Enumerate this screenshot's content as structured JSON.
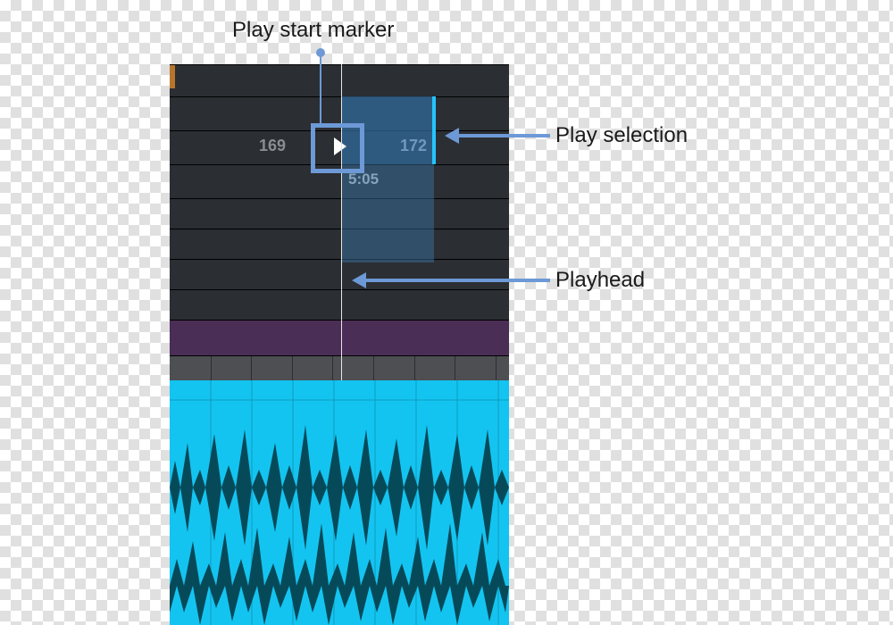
{
  "labels": {
    "play_start_marker": "Play start marker",
    "play_selection": "Play selection",
    "playhead": "Playhead"
  },
  "timeline": {
    "measure_left": "169",
    "measure_right": "172",
    "timecode": "5:05"
  },
  "icons": {
    "play_triangle": "play-icon"
  },
  "colors": {
    "callout": "#6d99d6",
    "waveform": "#14c4f0",
    "selection_edge": "#25c3ff",
    "purple_track": "#4a2e55"
  }
}
